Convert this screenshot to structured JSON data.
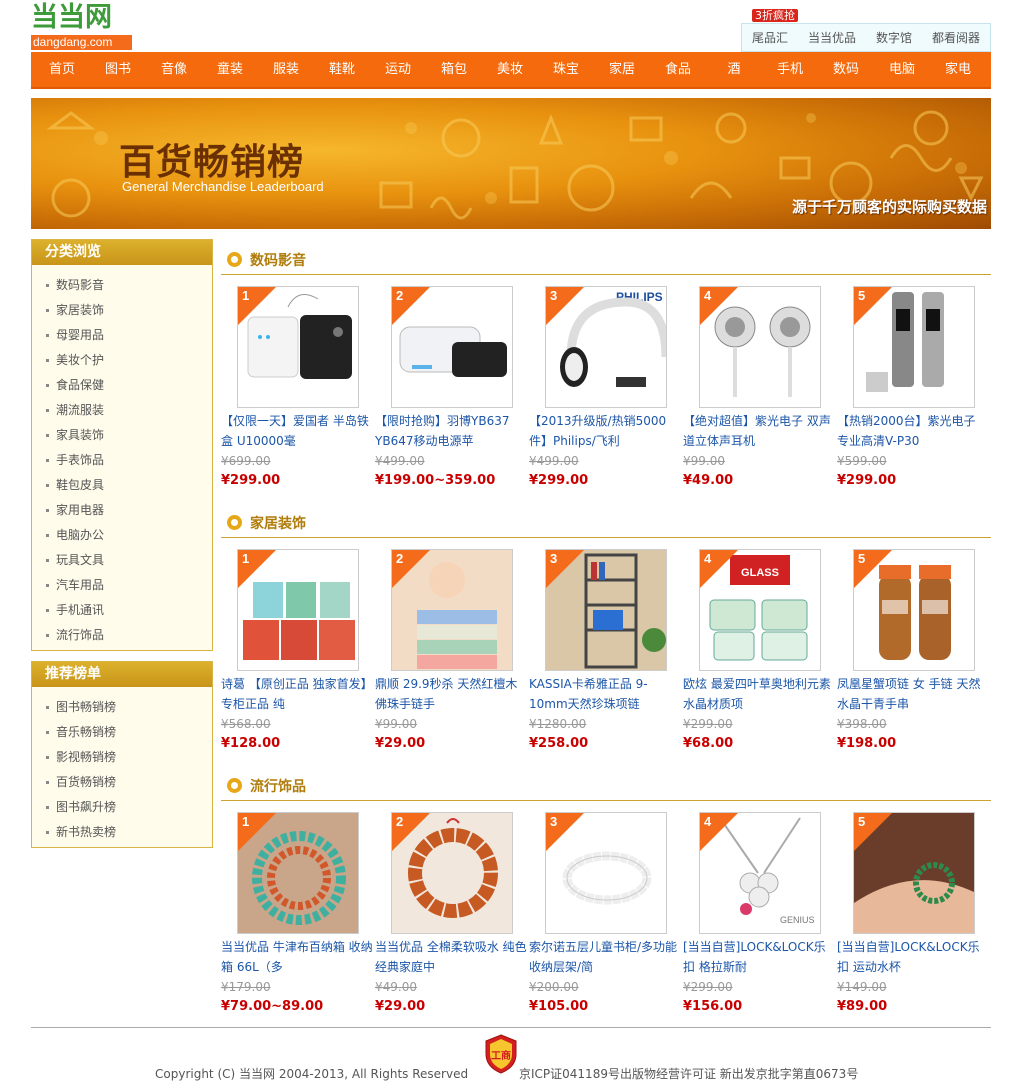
{
  "header": {
    "logo_cn": "当当网",
    "logo_en": "dangdang.com",
    "hot_badge": "3折疯抢",
    "top_links": [
      "尾品汇",
      "当当优品",
      "数字馆",
      "都看阅器"
    ]
  },
  "nav": [
    "首页",
    "图书",
    "音像",
    "童装",
    "服装",
    "鞋靴",
    "运动",
    "箱包",
    "美妆",
    "珠宝",
    "家居",
    "食品",
    "酒",
    "手机",
    "数码",
    "电脑",
    "家电"
  ],
  "banner": {
    "title": "百货畅销榜",
    "subtitle": "General Merchandise Leaderboard",
    "slogan": "源于千万顾客的实际购买数据"
  },
  "sidebar": {
    "categories": {
      "title": "分类浏览",
      "items": [
        "数码影音",
        "家居装饰",
        "母婴用品",
        "美妆个护",
        "食品保健",
        "潮流服装",
        "家具装饰",
        "手表饰品",
        "鞋包皮具",
        "家用电器",
        "电脑办公",
        "玩具文具",
        "汽车用品",
        "手机通讯",
        "流行饰品"
      ]
    },
    "rankings": {
      "title": "推荐榜单",
      "items": [
        "图书畅销榜",
        "音乐畅销榜",
        "影视畅销榜",
        "百货畅销榜",
        "图书飙升榜",
        "新书热卖榜"
      ]
    }
  },
  "sections": [
    {
      "title": "数码影音",
      "products": [
        {
          "rank": "1",
          "name": "【仅限一天】爱国者 半岛铁盒 U10000毫",
          "old": "¥699.00",
          "price": "¥299.00",
          "art": "powerbank"
        },
        {
          "rank": "2",
          "name": "【限时抢购】羽博YB637 YB647移动电源苹",
          "old": "¥499.00",
          "price": "¥199.00~359.00",
          "art": "powerbank2"
        },
        {
          "rank": "3",
          "name": "【2013升级版/热销5000件】Philips/飞利",
          "old": "¥499.00",
          "price": "¥299.00",
          "art": "headphone",
          "brand": "PHILIPS"
        },
        {
          "rank": "4",
          "name": "【绝对超值】紫光电子 双声道立体声耳机",
          "old": "¥99.00",
          "price": "¥49.00",
          "art": "earphone"
        },
        {
          "rank": "5",
          "name": "【热销2000台】紫光电子 专业高清V-P30",
          "old": "¥599.00",
          "price": "¥299.00",
          "art": "recorder"
        }
      ]
    },
    {
      "title": "家居装饰",
      "products": [
        {
          "rank": "1",
          "name": "诗葛 【原创正品 独家首发】专柜正品 纯",
          "old": "¥568.00",
          "price": "¥128.00",
          "art": "boxes"
        },
        {
          "rank": "2",
          "name": "鼎顺 29.9秒杀 天然红檀木佛珠手链手",
          "old": "¥99.00",
          "price": "¥29.00",
          "art": "towels"
        },
        {
          "rank": "3",
          "name": "KASSIA卡希雅正品 9-10mm天然珍珠项链",
          "old": "¥1280.00",
          "price": "¥258.00",
          "art": "shelf"
        },
        {
          "rank": "4",
          "name": "欧炫 最爱四叶草奥地利元素水晶材质项",
          "old": "¥299.00",
          "price": "¥68.00",
          "art": "glass",
          "brand": "GLASS"
        },
        {
          "rank": "5",
          "name": "凤凰星蟹项链 女 手链 天然水晶干青手串",
          "old": "¥398.00",
          "price": "¥198.00",
          "art": "bottle"
        }
      ]
    },
    {
      "title": "流行饰品",
      "products": [
        {
          "rank": "1",
          "name": "当当优品 牛津布百纳箱 收纳箱 66L（多",
          "old": "¥179.00",
          "price": "¥79.00~89.00",
          "art": "beads1"
        },
        {
          "rank": "2",
          "name": "当当优品 全棉柔软吸水 纯色经典家庭中",
          "old": "¥49.00",
          "price": "¥29.00",
          "art": "beads2"
        },
        {
          "rank": "3",
          "name": "索尔诺五层儿童书柜/多功能收纳层架/简",
          "old": "¥200.00",
          "price": "¥105.00",
          "art": "pearl"
        },
        {
          "rank": "4",
          "name": "[当当自营]LOCK&LOCK乐扣 格拉斯耐",
          "old": "¥299.00",
          "price": "¥156.00",
          "art": "necklace",
          "brand": "GENIUS"
        },
        {
          "rank": "5",
          "name": "[当当自营]LOCK&LOCK乐扣 运动水杯",
          "old": "¥149.00",
          "price": "¥89.00",
          "art": "bracelet"
        }
      ]
    }
  ],
  "footer": {
    "copyright": "Copyright (C) 当当网 2004-2013, All Rights Reserved",
    "icp": "京ICP证041189号出版物经营许可证 新出发京批字第直0673号",
    "seal": "工商"
  },
  "colors": {
    "brand_orange": "#f46a0c",
    "brand_green": "#3d9b3a",
    "price_red": "#c80000",
    "link_blue": "#1c56a8",
    "gold": "#d8b345"
  }
}
